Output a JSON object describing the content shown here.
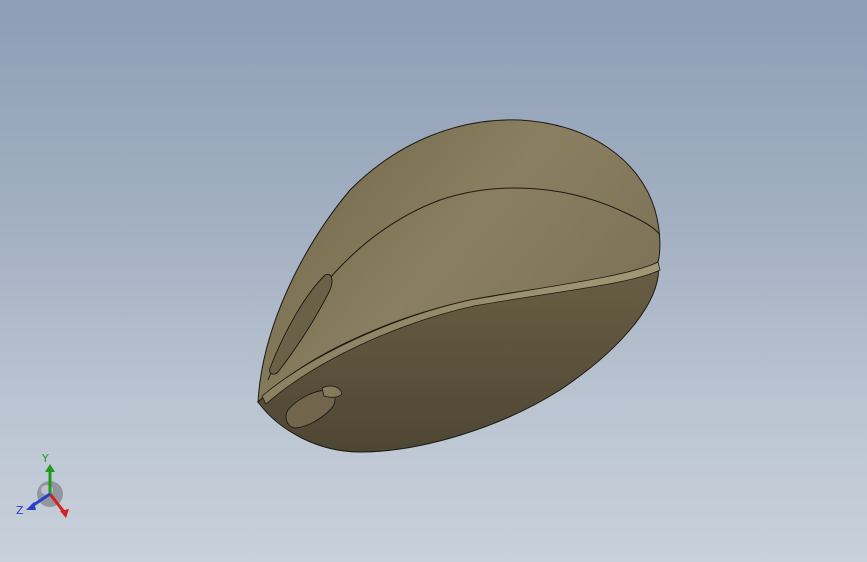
{
  "viewport": {
    "description_free": true
  },
  "model": {
    "body_color": "#7a6e55",
    "highlight_color": "#8c8262",
    "shadow_color": "#5b5340",
    "edge_color": "#1e1a12"
  },
  "triad": {
    "x_label": "",
    "y_label": "Y",
    "z_label": "Z",
    "x_color": "#d42020",
    "y_color": "#1f9a1f",
    "z_color": "#2a3fc4"
  }
}
